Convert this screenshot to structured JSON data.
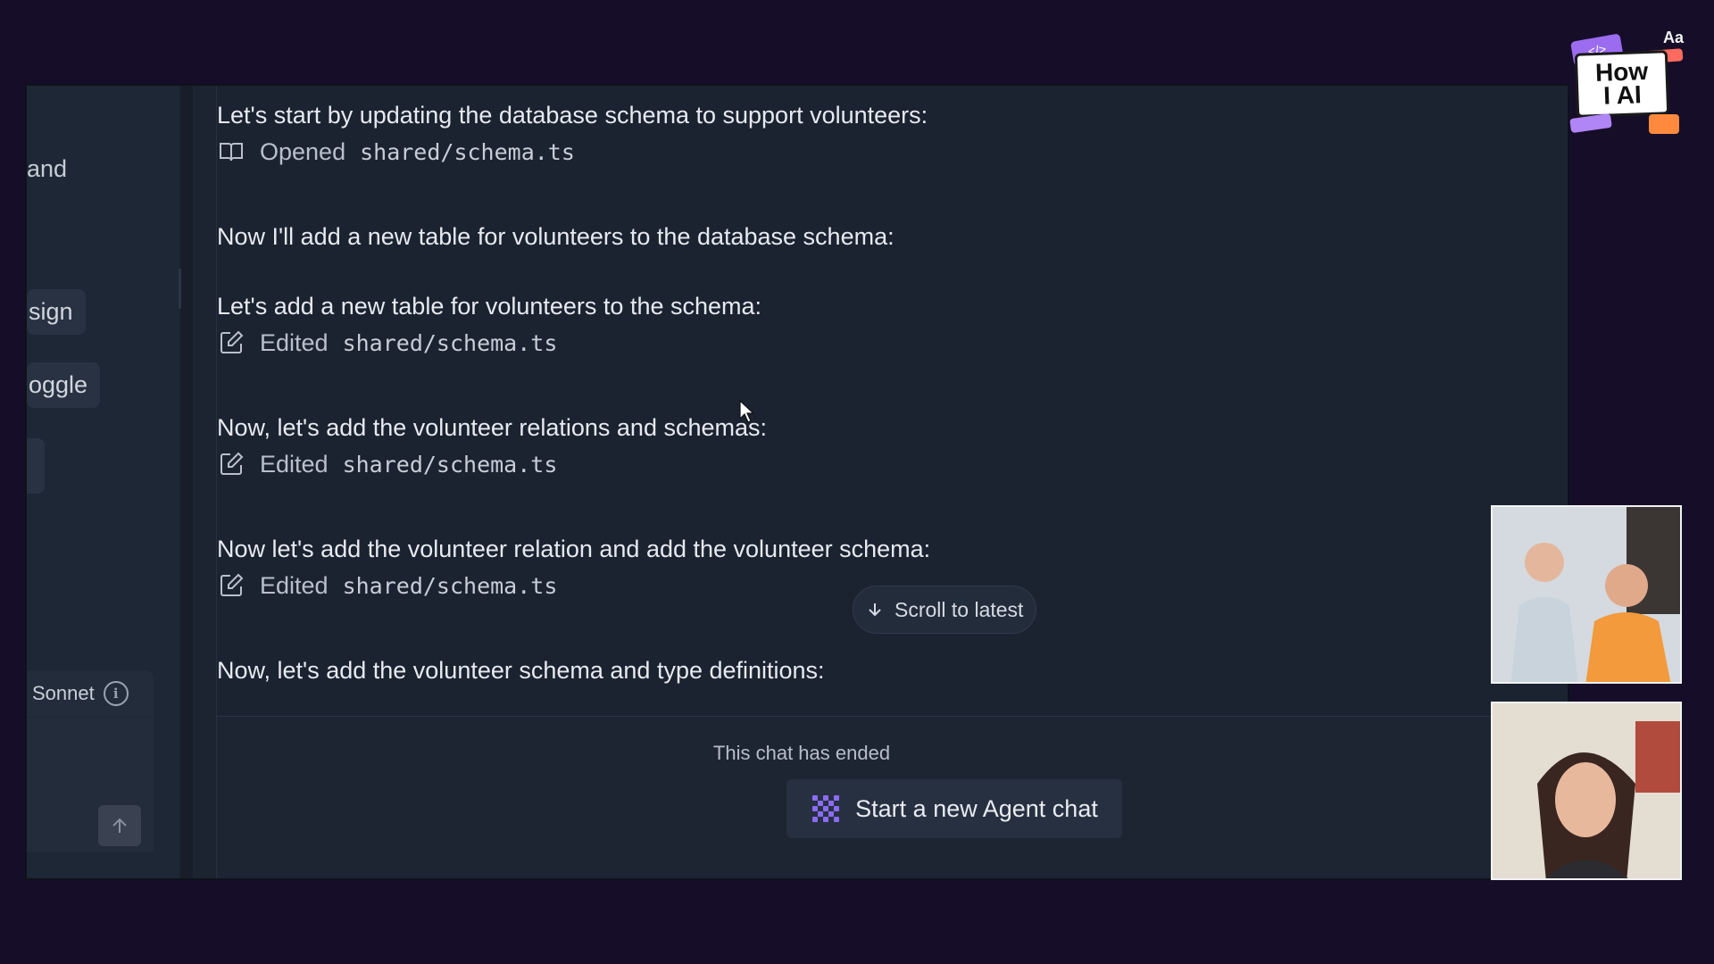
{
  "sidebar": {
    "fragment_1": "and",
    "chip_1": "sign",
    "chip_2": "oggle",
    "model_label": "Sonnet"
  },
  "chat": {
    "messages": [
      "Let's start by updating the database schema to support volunteers:",
      "Now I'll add a new table for volunteers to the database schema:",
      "Let's add a new table for volunteers to the schema:",
      "Now, let's add the volunteer relations and schemas:",
      "Now let's add the volunteer relation and add the volunteer schema:",
      "Now, let's add the volunteer schema and type definitions:"
    ],
    "actions": [
      {
        "verb": "Opened",
        "file": "shared/schema.ts",
        "icon": "book-icon"
      },
      {
        "verb": "Edited",
        "file": "shared/schema.ts",
        "icon": "edit-icon"
      },
      {
        "verb": "Edited",
        "file": "shared/schema.ts",
        "icon": "edit-icon"
      },
      {
        "verb": "Edited",
        "file": "shared/schema.ts",
        "icon": "edit-icon"
      }
    ],
    "scroll_button": "Scroll to latest",
    "ended_text": "This chat has ended",
    "new_chat_button": "Start a new Agent chat"
  },
  "logo": {
    "line1": "How",
    "line2": "I AI",
    "corner": "Aa"
  },
  "colors": {
    "background": "#160e29",
    "panel": "#1b2331",
    "agent_icon": "#8b6cf6"
  }
}
